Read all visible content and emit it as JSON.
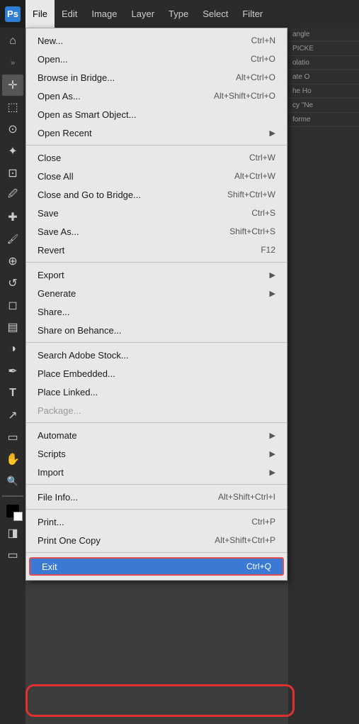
{
  "app": {
    "title": "Photoshop",
    "ps_label": "Ps"
  },
  "menubar": {
    "items": [
      {
        "id": "file",
        "label": "File",
        "active": true
      },
      {
        "id": "edit",
        "label": "Edit",
        "active": false
      },
      {
        "id": "image",
        "label": "Image",
        "active": false
      },
      {
        "id": "layer",
        "label": "Layer",
        "active": false
      },
      {
        "id": "type",
        "label": "Type",
        "active": false
      },
      {
        "id": "select",
        "label": "Select",
        "active": false
      },
      {
        "id": "filter",
        "label": "Filter",
        "active": false
      }
    ]
  },
  "file_menu": {
    "sections": [
      {
        "items": [
          {
            "id": "new",
            "label": "New...",
            "shortcut": "Ctrl+N",
            "has_arrow": false,
            "disabled": false
          },
          {
            "id": "open",
            "label": "Open...",
            "shortcut": "Ctrl+O",
            "has_arrow": false,
            "disabled": false
          },
          {
            "id": "browse-bridge",
            "label": "Browse in Bridge...",
            "shortcut": "Alt+Ctrl+O",
            "has_arrow": false,
            "disabled": false
          },
          {
            "id": "open-as",
            "label": "Open As...",
            "shortcut": "Alt+Shift+Ctrl+O",
            "has_arrow": false,
            "disabled": false
          },
          {
            "id": "open-smart",
            "label": "Open as Smart Object...",
            "shortcut": "",
            "has_arrow": false,
            "disabled": false
          },
          {
            "id": "open-recent",
            "label": "Open Recent",
            "shortcut": "",
            "has_arrow": true,
            "disabled": false
          }
        ]
      },
      {
        "items": [
          {
            "id": "close",
            "label": "Close",
            "shortcut": "Ctrl+W",
            "has_arrow": false,
            "disabled": false
          },
          {
            "id": "close-all",
            "label": "Close All",
            "shortcut": "Alt+Ctrl+W",
            "has_arrow": false,
            "disabled": false
          },
          {
            "id": "close-bridge",
            "label": "Close and Go to Bridge...",
            "shortcut": "Shift+Ctrl+W",
            "has_arrow": false,
            "disabled": false
          },
          {
            "id": "save",
            "label": "Save",
            "shortcut": "Ctrl+S",
            "has_arrow": false,
            "disabled": false
          },
          {
            "id": "save-as",
            "label": "Save As...",
            "shortcut": "Shift+Ctrl+S",
            "has_arrow": false,
            "disabled": false
          },
          {
            "id": "revert",
            "label": "Revert",
            "shortcut": "F12",
            "has_arrow": false,
            "disabled": false
          }
        ]
      },
      {
        "items": [
          {
            "id": "export",
            "label": "Export",
            "shortcut": "",
            "has_arrow": true,
            "disabled": false
          },
          {
            "id": "generate",
            "label": "Generate",
            "shortcut": "",
            "has_arrow": true,
            "disabled": false
          },
          {
            "id": "share",
            "label": "Share...",
            "shortcut": "",
            "has_arrow": false,
            "disabled": false
          },
          {
            "id": "share-behance",
            "label": "Share on Behance...",
            "shortcut": "",
            "has_arrow": false,
            "disabled": false
          }
        ]
      },
      {
        "items": [
          {
            "id": "search-stock",
            "label": "Search Adobe Stock...",
            "shortcut": "",
            "has_arrow": false,
            "disabled": false
          },
          {
            "id": "place-embedded",
            "label": "Place Embedded...",
            "shortcut": "",
            "has_arrow": false,
            "disabled": false
          },
          {
            "id": "place-linked",
            "label": "Place Linked...",
            "shortcut": "",
            "has_arrow": false,
            "disabled": false
          },
          {
            "id": "package",
            "label": "Package...",
            "shortcut": "",
            "has_arrow": false,
            "disabled": true
          }
        ]
      },
      {
        "items": [
          {
            "id": "automate",
            "label": "Automate",
            "shortcut": "",
            "has_arrow": true,
            "disabled": false
          },
          {
            "id": "scripts",
            "label": "Scripts",
            "shortcut": "",
            "has_arrow": true,
            "disabled": false
          },
          {
            "id": "import",
            "label": "Import",
            "shortcut": "",
            "has_arrow": true,
            "disabled": false
          }
        ]
      },
      {
        "items": [
          {
            "id": "file-info",
            "label": "File Info...",
            "shortcut": "Alt+Shift+Ctrl+I",
            "has_arrow": false,
            "disabled": false
          }
        ]
      },
      {
        "items": [
          {
            "id": "print",
            "label": "Print...",
            "shortcut": "Ctrl+P",
            "has_arrow": false,
            "disabled": false
          },
          {
            "id": "print-one",
            "label": "Print One Copy",
            "shortcut": "Alt+Shift+Ctrl+P",
            "has_arrow": false,
            "disabled": false
          }
        ]
      },
      {
        "items": [
          {
            "id": "exit",
            "label": "Exit",
            "shortcut": "Ctrl+Q",
            "has_arrow": false,
            "disabled": false,
            "highlighted": true
          }
        ]
      }
    ]
  },
  "toolbar": {
    "tools": [
      {
        "id": "home",
        "icon": "⌂"
      },
      {
        "id": "move",
        "icon": "✛"
      },
      {
        "id": "select-rect",
        "icon": "⬚"
      },
      {
        "id": "lasso",
        "icon": "⊙"
      },
      {
        "id": "magic-wand",
        "icon": "✦"
      },
      {
        "id": "crop",
        "icon": "⊡"
      },
      {
        "id": "eyedropper",
        "icon": "🖉"
      },
      {
        "id": "healing",
        "icon": "✚"
      },
      {
        "id": "brush",
        "icon": "🖌"
      },
      {
        "id": "stamp",
        "icon": "⊕"
      },
      {
        "id": "history-brush",
        "icon": "↺"
      },
      {
        "id": "eraser",
        "icon": "◻"
      },
      {
        "id": "gradient",
        "icon": "▤"
      },
      {
        "id": "dodge",
        "icon": "◑"
      },
      {
        "id": "pen",
        "icon": "✒"
      },
      {
        "id": "type",
        "icon": "T"
      },
      {
        "id": "path-select",
        "icon": "↗"
      },
      {
        "id": "shape",
        "icon": "▭"
      },
      {
        "id": "hand",
        "icon": "✋"
      },
      {
        "id": "zoom",
        "icon": "🔍"
      },
      {
        "id": "foreground",
        "icon": "◼"
      },
      {
        "id": "quick-mask",
        "icon": "◨"
      }
    ]
  }
}
